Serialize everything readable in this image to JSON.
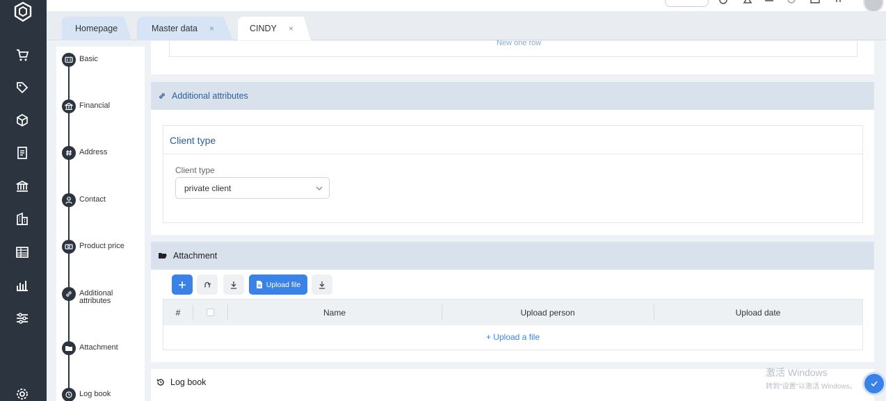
{
  "app": {
    "nav_icons": [
      "app-logo",
      "cart-icon",
      "tag-icon",
      "package-icon",
      "invoice-icon",
      "bank-icon",
      "building-icon",
      "table-icon",
      "bar-chart-icon",
      "sliders-icon",
      "settings-icon"
    ]
  },
  "tabs": [
    {
      "label": "Homepage",
      "closable": false
    },
    {
      "label": "Master data",
      "closable": true
    },
    {
      "label": "CINDY",
      "closable": true,
      "active": true
    }
  ],
  "tab_close_glyph": "×",
  "steps": [
    {
      "label": "Basic",
      "icon": "id-card-icon"
    },
    {
      "label": "Financial",
      "icon": "bank-icon"
    },
    {
      "label": "Address",
      "icon": "hash-icon"
    },
    {
      "label": "Contact",
      "icon": "person-icon"
    },
    {
      "label": "Product price",
      "icon": "money-icon"
    },
    {
      "label": "Additional attributes",
      "icon": "link-icon"
    },
    {
      "label": "Attachment",
      "icon": "folder-icon"
    },
    {
      "label": "Log book",
      "icon": "history-icon"
    }
  ],
  "top_card": {
    "cut_text": "New one row"
  },
  "additional_attributes": {
    "title": "Additional attributes",
    "group_title": "Client type",
    "field_label": "Client type",
    "field_value": "private client"
  },
  "attachment": {
    "title": "Attachment",
    "upload_button": "Upload file",
    "columns": [
      "#",
      "",
      "Name",
      "Upload person",
      "Upload date"
    ],
    "empty_link": "+ Upload a file"
  },
  "log_book": {
    "title": "Log book"
  },
  "watermark": {
    "line1": "激活 Windows",
    "line2": "转到\"设置\"以激活 Windows。"
  },
  "colors": {
    "accent": "#3b82e6",
    "rail": "#2c3440",
    "section_head": "#d9e2ec",
    "title_blue": "#2d5f96"
  }
}
